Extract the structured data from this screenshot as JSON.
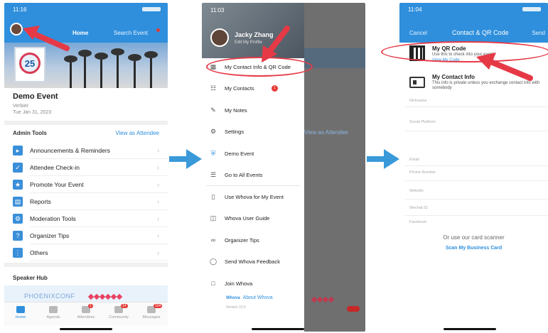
{
  "screen1": {
    "status_time": "11:16",
    "tabs": {
      "home": "Home",
      "search": "Search Event"
    },
    "event": {
      "title": "Demo Event",
      "location": "Verbier",
      "date": "Tue Jan 31, 2023"
    },
    "admin_tools": {
      "title": "Admin Tools",
      "link": "View as Attendee",
      "items": [
        {
          "label": "Announcements & Reminders",
          "icon": "megaphone-icon"
        },
        {
          "label": "Attendee Check-in",
          "icon": "checkin-icon"
        },
        {
          "label": "Promote Your Event",
          "icon": "promote-icon"
        },
        {
          "label": "Reports",
          "icon": "report-icon"
        },
        {
          "label": "Moderation Tools",
          "icon": "moderation-icon"
        },
        {
          "label": "Organizer Tips",
          "icon": "tips-icon"
        },
        {
          "label": "Others",
          "icon": "more-icon"
        }
      ]
    },
    "speaker_hub": {
      "title": "Speaker Hub"
    },
    "logo_number": "25",
    "banner_text": "PHOENIXCONF",
    "bottom_nav": [
      {
        "label": "Home",
        "badge": ""
      },
      {
        "label": "Agenda",
        "badge": ""
      },
      {
        "label": "Attendees",
        "badge": "1"
      },
      {
        "label": "Community",
        "badge": "14"
      },
      {
        "label": "Messages",
        "badge": "104"
      }
    ]
  },
  "screen2": {
    "status_time": "11:03",
    "user_name": "Jacky Zhang",
    "edit_profile": "Edit My Profile",
    "dim_link": "View as Attendee",
    "menu": [
      {
        "label": "My Contact Info & QR Code",
        "icon": "qr-icon"
      },
      {
        "label": "My Contacts",
        "icon": "contacts-icon",
        "badge": "1"
      },
      {
        "label": "My Notes",
        "icon": "pencil-icon"
      },
      {
        "label": "Settings",
        "icon": "gear-icon"
      },
      {
        "label": "Demo Event",
        "icon": "shield-icon"
      },
      {
        "label": "Go to All Events",
        "icon": "list-icon"
      },
      {
        "label": "Use Whova for My Event",
        "icon": "phone-icon"
      },
      {
        "label": "Whova User Guide",
        "icon": "guide-icon"
      },
      {
        "label": "Organizer Tips",
        "icon": "glasses-icon"
      },
      {
        "label": "Send Whova Feedback",
        "icon": "chat-icon"
      },
      {
        "label": "Join Whova",
        "icon": "doc-icon"
      }
    ],
    "about_logo": "Whova",
    "about": "About Whova",
    "about_sub": "Version 10.5"
  },
  "screen3": {
    "status_time": "11:04",
    "cancel": "Cancel",
    "title": "Contact & QR Code",
    "send": "Send",
    "qr": {
      "title": "My QR Code",
      "desc": "Use this to check into your event",
      "link": "View My Code"
    },
    "contact": {
      "title": "My Contact Info",
      "desc": "This info is private unless you exchange contact info with somebody"
    },
    "fields": [
      "Nickname",
      "Social Platform",
      "Email",
      "Phone Number",
      "Website",
      "Wechat ID",
      "Facebook"
    ],
    "scanner_text": "Or use our card scanner",
    "scanner_link": "Scan My Business Card"
  },
  "colors": {
    "accent": "#2f8fdc",
    "highlight": "#e63946",
    "flow_arrow": "#3a9ad9"
  }
}
